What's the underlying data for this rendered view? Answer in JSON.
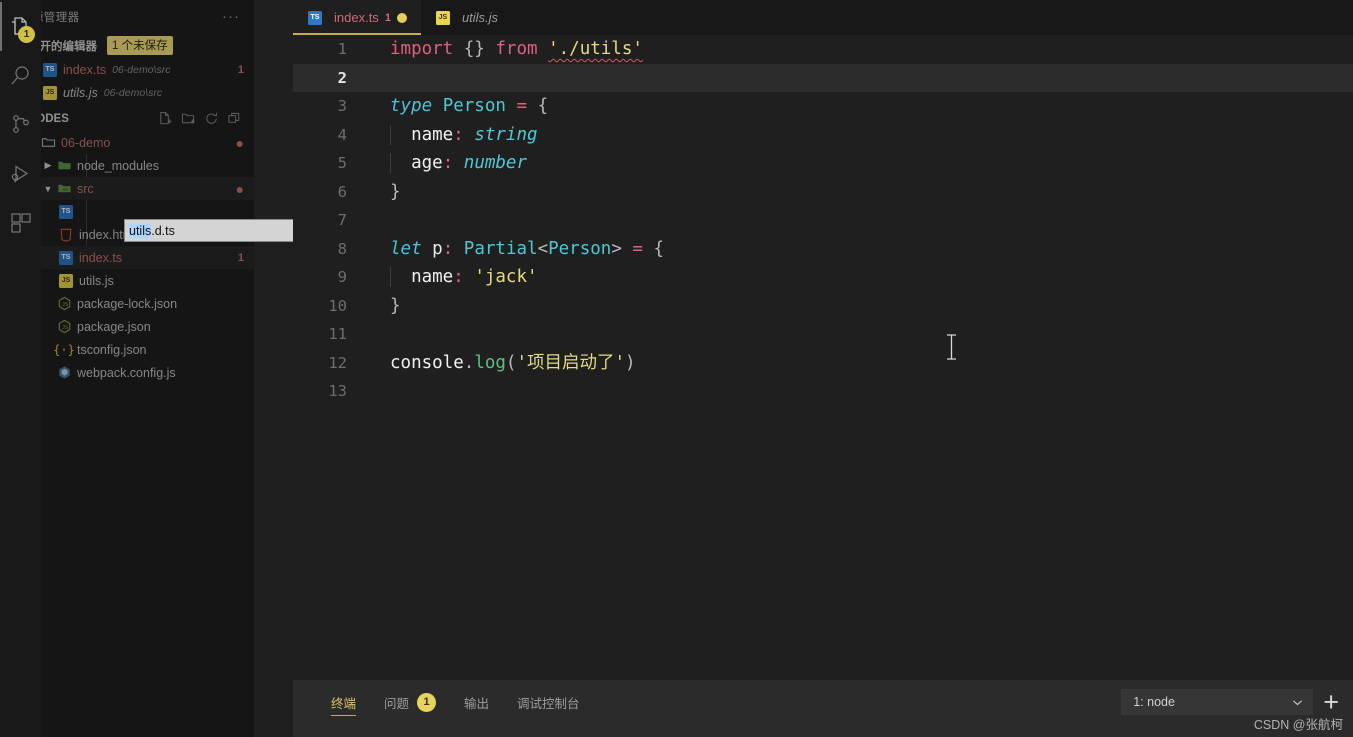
{
  "activitybar": {
    "items": [
      {
        "name": "explorer",
        "icon": "files-icon",
        "badge": "1",
        "active": true
      },
      {
        "name": "search",
        "icon": "search-icon",
        "badge": "",
        "active": false
      },
      {
        "name": "source-control",
        "icon": "source-control-icon",
        "badge": "",
        "active": false
      },
      {
        "name": "run-debug",
        "icon": "run-debug-icon",
        "badge": "",
        "active": false
      },
      {
        "name": "extensions",
        "icon": "extensions-icon",
        "badge": "",
        "active": false
      }
    ]
  },
  "sidebar": {
    "title": "资源管理器",
    "more_label": "···",
    "open_editors": {
      "label": "打开的编辑器",
      "badge": "1 个未保存",
      "items": [
        {
          "name": "index.ts",
          "path": "06-demo\\src",
          "icon": "ts-icon",
          "icon_text": "TS",
          "dirty": true,
          "count": "1",
          "modified": true,
          "italic": false
        },
        {
          "name": "utils.js",
          "path": "06-demo\\src",
          "icon": "js-icon",
          "icon_text": "JS",
          "dirty": false,
          "count": "",
          "modified": false,
          "italic": true
        }
      ]
    },
    "workspace": {
      "label": "CODES",
      "actions": [
        "new-file-icon",
        "new-folder-icon",
        "refresh-icon",
        "collapse-all-icon"
      ],
      "tree": [
        {
          "label": "06-demo",
          "type": "folder",
          "indent": 1,
          "expanded": true,
          "modified": true,
          "dot": true,
          "icon": "folder-icon"
        },
        {
          "label": "node_modules",
          "type": "folder",
          "indent": 2,
          "expanded": false,
          "modified": false,
          "dot": false,
          "icon": "folder-node-icon"
        },
        {
          "label": "src",
          "type": "folder",
          "indent": 2,
          "expanded": true,
          "modified": true,
          "dot": true,
          "icon": "folder-src-icon",
          "selected": true
        },
        {
          "label": "index.html",
          "type": "file",
          "indent": 3,
          "icon": "html-icon",
          "icon_text": "5",
          "modified": false,
          "count": ""
        },
        {
          "label": "index.ts",
          "type": "file",
          "indent": 3,
          "icon": "ts-icon",
          "icon_text": "TS",
          "modified": true,
          "count": "1",
          "selected": true
        },
        {
          "label": "utils.js",
          "type": "file",
          "indent": 3,
          "icon": "js-icon",
          "icon_text": "JS",
          "modified": false,
          "count": ""
        },
        {
          "label": "package-lock.json",
          "type": "file",
          "indent": 2,
          "icon": "npm-icon",
          "modified": false,
          "count": ""
        },
        {
          "label": "package.json",
          "type": "file",
          "indent": 2,
          "icon": "npm-icon",
          "modified": false,
          "count": ""
        },
        {
          "label": "tsconfig.json",
          "type": "file",
          "indent": 2,
          "icon": "tsconfig-icon",
          "modified": false,
          "count": ""
        },
        {
          "label": "webpack.config.js",
          "type": "file",
          "indent": 2,
          "icon": "webpack-icon",
          "modified": false,
          "count": ""
        }
      ]
    },
    "rename_input": {
      "value": "utils.d.ts",
      "icon": "ts-icon",
      "icon_text": "TS"
    }
  },
  "editor": {
    "tabs": [
      {
        "label": "index.ts",
        "icon": "ts-icon",
        "icon_text": "TS",
        "error_count": "1",
        "dirty": true,
        "active": true
      },
      {
        "label": "utils.js",
        "icon": "js-icon",
        "icon_text": "JS",
        "error_count": "",
        "dirty": false,
        "active": false
      }
    ],
    "active_line": 2,
    "lines": [
      {
        "n": "1",
        "text": "import {} from './utils'"
      },
      {
        "n": "2",
        "text": ""
      },
      {
        "n": "3",
        "text": "type Person = {"
      },
      {
        "n": "4",
        "text": "  name: string"
      },
      {
        "n": "5",
        "text": "  age: number"
      },
      {
        "n": "6",
        "text": "}"
      },
      {
        "n": "7",
        "text": ""
      },
      {
        "n": "8",
        "text": "let p: Partial<Person> = {"
      },
      {
        "n": "9",
        "text": "  name: 'jack'"
      },
      {
        "n": "10",
        "text": "}"
      },
      {
        "n": "11",
        "text": ""
      },
      {
        "n": "12",
        "text": "console.log('项目启动了')"
      },
      {
        "n": "13",
        "text": ""
      }
    ]
  },
  "panel": {
    "tabs": [
      {
        "label": "终端",
        "badge": "",
        "active": true
      },
      {
        "label": "问题",
        "badge": "1",
        "active": false
      },
      {
        "label": "输出",
        "badge": "",
        "active": false
      },
      {
        "label": "调试控制台",
        "badge": "",
        "active": false
      }
    ],
    "terminal_select": "1: node",
    "new_terminal_label": "+"
  },
  "watermark": "CSDN @张航柯",
  "colors": {
    "accent_yellow": "#c8b048",
    "badge_yellow": "#e8d45c",
    "modified_red": "#c4706c",
    "editor_bg": "#1f1f1f",
    "sidebar_bg": "#1f1f1f",
    "panel_bg": "#2b2b2b",
    "activitybar_bg": "#191919"
  }
}
